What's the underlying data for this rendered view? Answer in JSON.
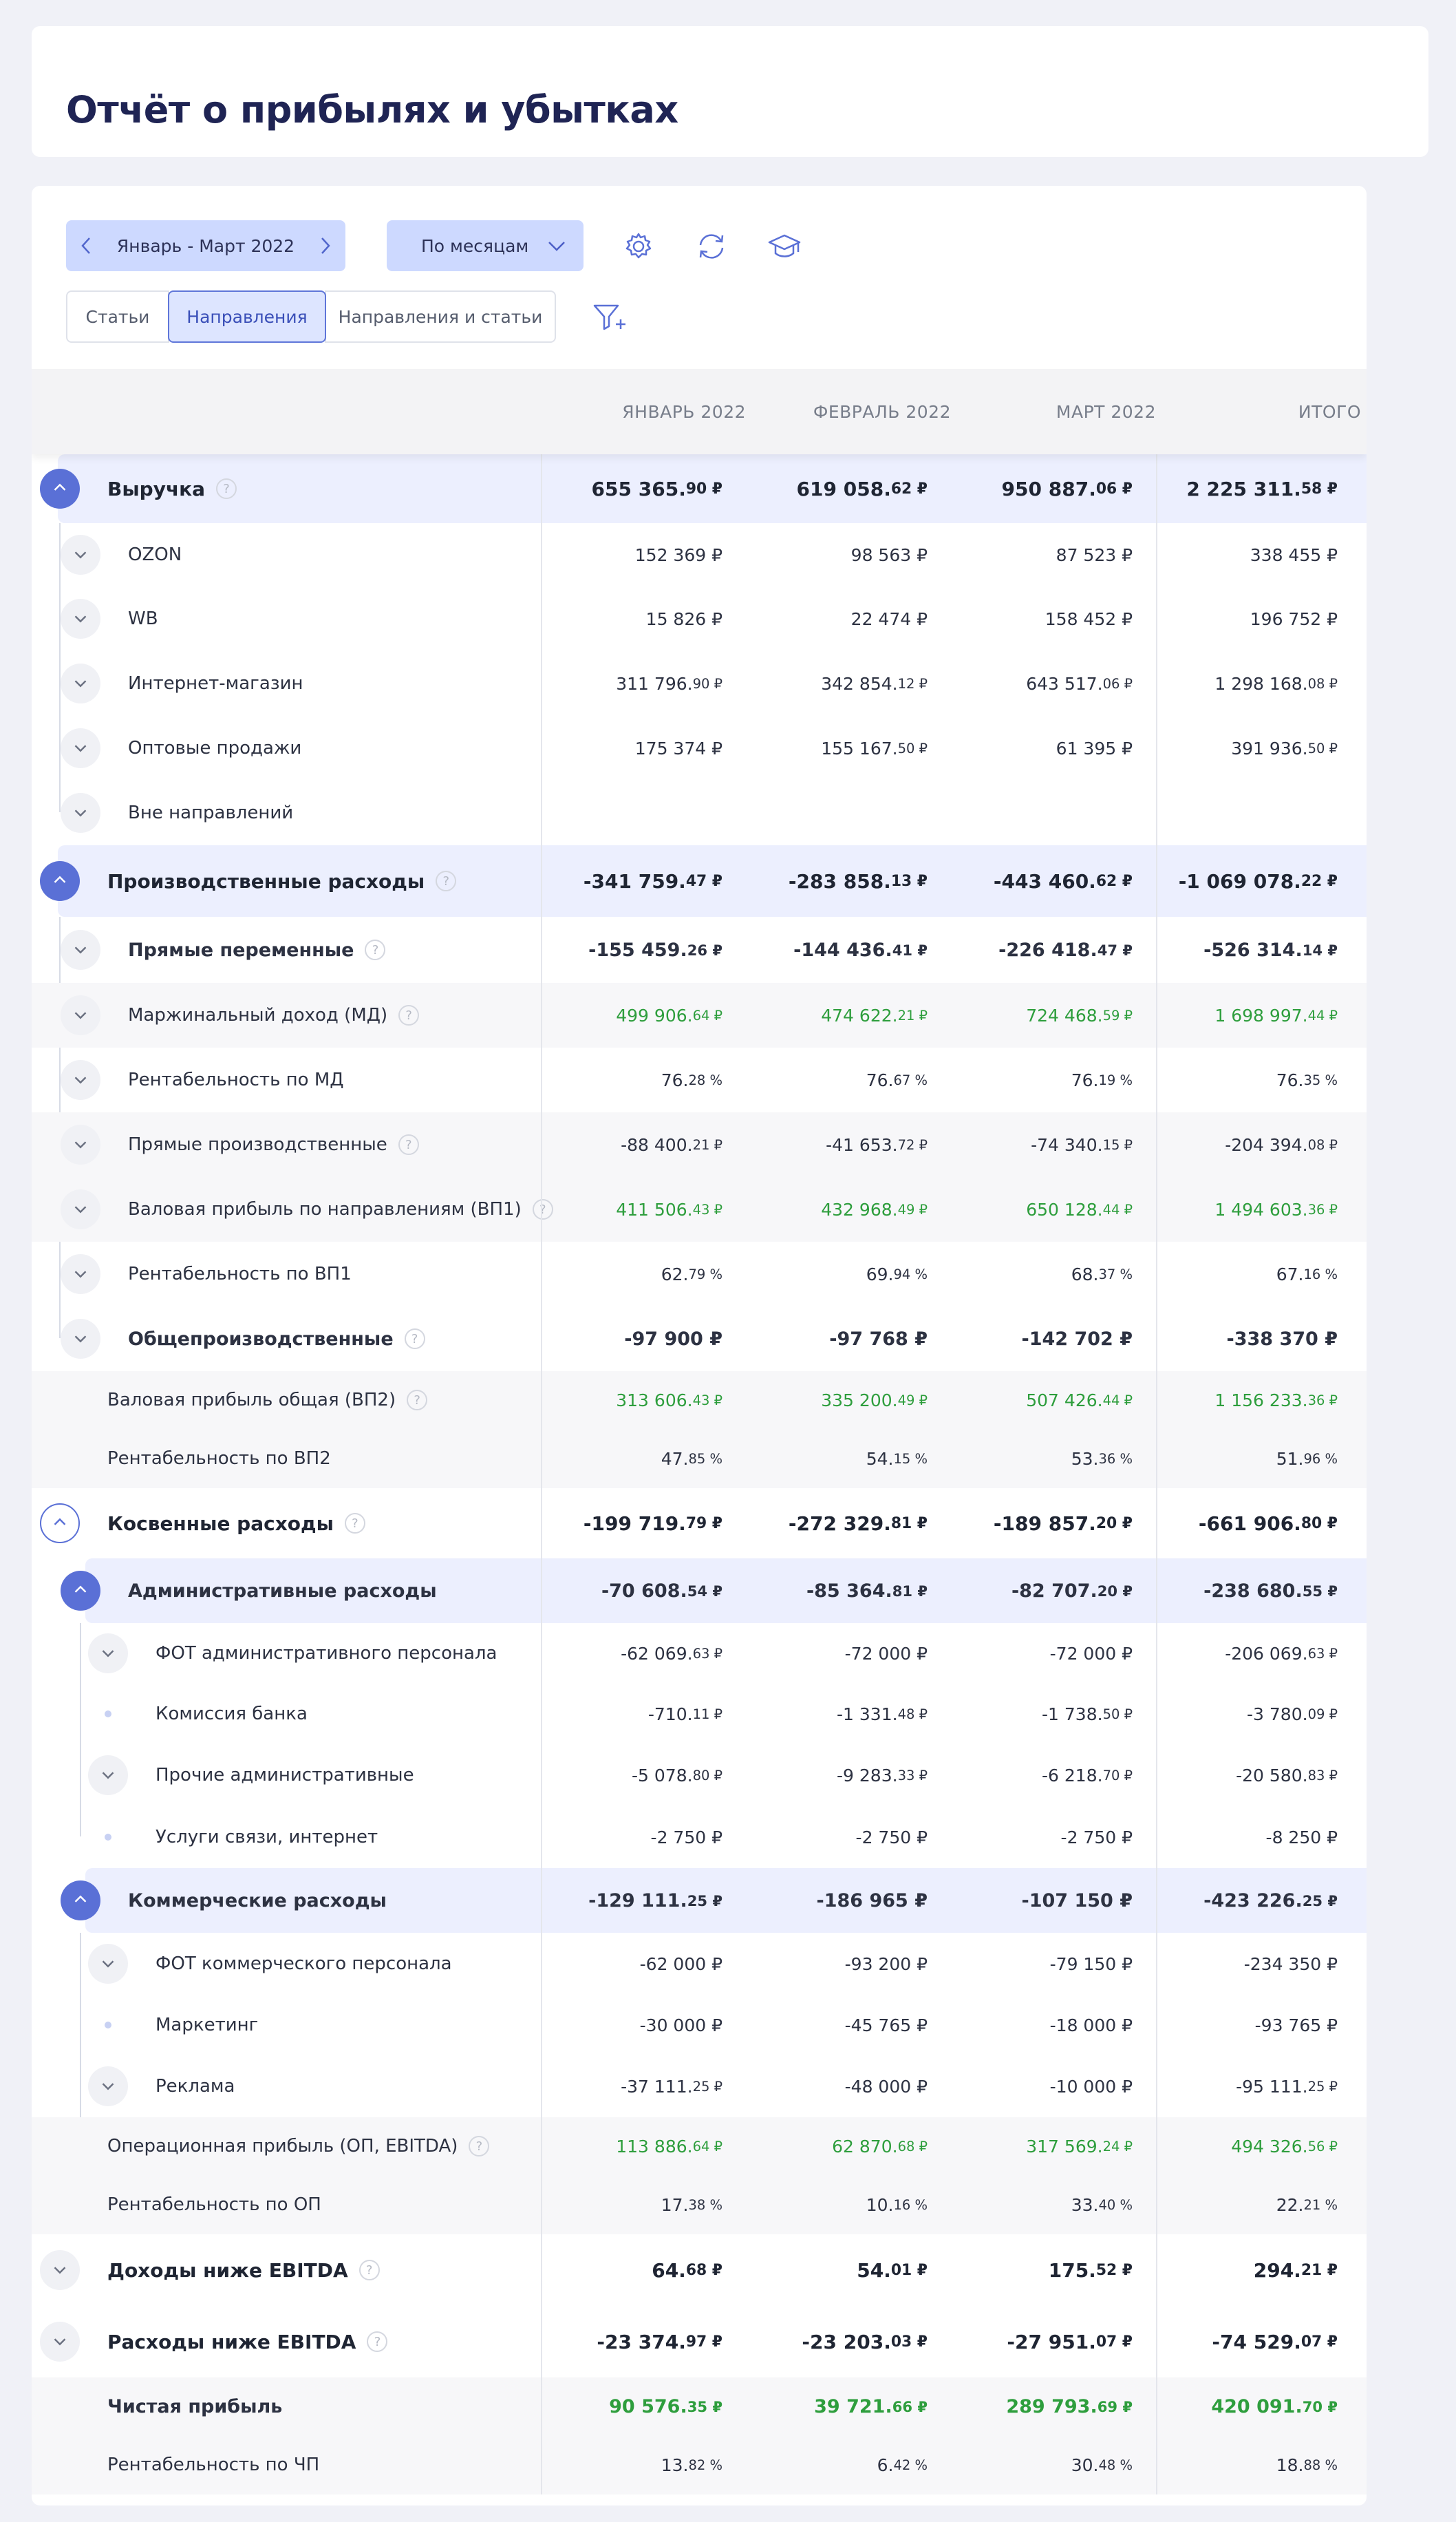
{
  "page": {
    "title": "Отчёт о прибылях и убытках"
  },
  "toolbar": {
    "period_label": "Январь - Март 2022",
    "group_by": "По месяцам",
    "icons": [
      "gear-icon",
      "refresh-icon",
      "graduation-cap-icon",
      "filter-plus-icon"
    ],
    "accent": "#5a70d6"
  },
  "tabs": [
    {
      "label": "Статьи"
    },
    {
      "label": "Направления",
      "active": true
    },
    {
      "label": "Направления и статьи"
    }
  ],
  "columns": [
    "ЯНВАРЬ 2022",
    "ФЕВРАЛЬ 2022",
    "МАРТ 2022",
    "ИТОГО"
  ],
  "rows": [
    {
      "label": "Выручка",
      "vals": [
        [
          "655 365.",
          "90 ₽"
        ],
        [
          "619 058.",
          "62 ₽"
        ],
        [
          "950 887.",
          "06 ₽"
        ],
        [
          "2 225 311.",
          "58 ₽"
        ]
      ]
    },
    {
      "label": "OZON",
      "vals": [
        [
          "152 369 ₽",
          ""
        ],
        [
          "98 563 ₽",
          ""
        ],
        [
          "87 523 ₽",
          ""
        ],
        [
          "338 455 ₽",
          ""
        ]
      ]
    },
    {
      "label": "WB",
      "vals": [
        [
          "15 826 ₽",
          ""
        ],
        [
          "22 474 ₽",
          ""
        ],
        [
          "158 452 ₽",
          ""
        ],
        [
          "196 752 ₽",
          ""
        ]
      ]
    },
    {
      "label": "Интернет-магазин",
      "vals": [
        [
          "311 796.",
          "90 ₽"
        ],
        [
          "342 854.",
          "12 ₽"
        ],
        [
          "643 517.",
          "06 ₽"
        ],
        [
          "1 298 168.",
          "08 ₽"
        ]
      ]
    },
    {
      "label": "Оптовые продажи",
      "vals": [
        [
          "175 374 ₽",
          ""
        ],
        [
          "155 167.",
          "50 ₽"
        ],
        [
          "61 395 ₽",
          ""
        ],
        [
          "391 936.",
          "50 ₽"
        ]
      ]
    },
    {
      "label": "Вне направлений",
      "vals": []
    },
    {
      "label": "Производственные расходы",
      "vals": [
        [
          "-341 759.",
          "47 ₽"
        ],
        [
          "-283 858.",
          "13 ₽"
        ],
        [
          "-443 460.",
          "62 ₽"
        ],
        [
          "-1 069 078.",
          "22 ₽"
        ]
      ]
    },
    {
      "label": "Прямые переменные",
      "vals": [
        [
          "-155 459.",
          "26 ₽"
        ],
        [
          "-144 436.",
          "41 ₽"
        ],
        [
          "-226 418.",
          "47 ₽"
        ],
        [
          "-526 314.",
          "14 ₽"
        ]
      ]
    },
    {
      "label": "Маржинальный доход (МД)",
      "vals": [
        [
          "499 906.",
          "64 ₽"
        ],
        [
          "474 622.",
          "21 ₽"
        ],
        [
          "724 468.",
          "59 ₽"
        ],
        [
          "1 698 997.",
          "44 ₽"
        ]
      ]
    },
    {
      "label": "Рентабельность по МД",
      "vals": [
        [
          "76.",
          "28 %"
        ],
        [
          "76.",
          "67 %"
        ],
        [
          "76.",
          "19 %"
        ],
        [
          "76.",
          "35 %"
        ]
      ]
    },
    {
      "label": "Прямые производственные",
      "vals": [
        [
          "-88 400.",
          "21 ₽"
        ],
        [
          "-41 653.",
          "72 ₽"
        ],
        [
          "-74 340.",
          "15 ₽"
        ],
        [
          "-204 394.",
          "08 ₽"
        ]
      ]
    },
    {
      "label": "Валовая прибыль по направлениям (ВП1)",
      "vals": [
        [
          "411 506.",
          "43 ₽"
        ],
        [
          "432 968.",
          "49 ₽"
        ],
        [
          "650 128.",
          "44 ₽"
        ],
        [
          "1 494 603.",
          "36 ₽"
        ]
      ]
    },
    {
      "label": "Рентабельность по ВП1",
      "vals": [
        [
          "62.",
          "79 %"
        ],
        [
          "69.",
          "94 %"
        ],
        [
          "68.",
          "37 %"
        ],
        [
          "67.",
          "16 %"
        ]
      ]
    },
    {
      "label": "Общепроизводственные",
      "vals": [
        [
          "-97 900 ₽",
          ""
        ],
        [
          "-97 768 ₽",
          ""
        ],
        [
          "-142 702 ₽",
          ""
        ],
        [
          "-338 370 ₽",
          ""
        ]
      ]
    },
    {
      "label": "Валовая прибыль общая (ВП2)",
      "vals": [
        [
          "313 606.",
          "43 ₽"
        ],
        [
          "335 200.",
          "49 ₽"
        ],
        [
          "507 426.",
          "44 ₽"
        ],
        [
          "1 156 233.",
          "36 ₽"
        ]
      ]
    },
    {
      "label": "Рентабельность по ВП2",
      "vals": [
        [
          "47.",
          "85 %"
        ],
        [
          "54.",
          "15 %"
        ],
        [
          "53.",
          "36 %"
        ],
        [
          "51.",
          "96 %"
        ]
      ]
    },
    {
      "label": "Косвенные расходы",
      "vals": [
        [
          "-199 719.",
          "79 ₽"
        ],
        [
          "-272 329.",
          "81 ₽"
        ],
        [
          "-189 857.",
          "20 ₽"
        ],
        [
          "-661 906.",
          "80 ₽"
        ]
      ]
    },
    {
      "label": "Административные расходы",
      "vals": [
        [
          "-70 608.",
          "54 ₽"
        ],
        [
          "-85 364.",
          "81 ₽"
        ],
        [
          "-82 707.",
          "20 ₽"
        ],
        [
          "-238 680.",
          "55 ₽"
        ]
      ]
    },
    {
      "label": "ФОТ административного персонала",
      "vals": [
        [
          "-62 069.",
          "63 ₽"
        ],
        [
          "-72 000 ₽",
          ""
        ],
        [
          "-72 000 ₽",
          ""
        ],
        [
          "-206 069.",
          "63 ₽"
        ]
      ]
    },
    {
      "label": "Комиссия банка",
      "vals": [
        [
          "-710.",
          "11 ₽"
        ],
        [
          "-1 331.",
          "48 ₽"
        ],
        [
          "-1 738.",
          "50 ₽"
        ],
        [
          "-3 780.",
          "09 ₽"
        ]
      ]
    },
    {
      "label": "Прочие административные",
      "vals": [
        [
          "-5 078.",
          "80 ₽"
        ],
        [
          "-9 283.",
          "33 ₽"
        ],
        [
          "-6 218.",
          "70 ₽"
        ],
        [
          "-20 580.",
          "83 ₽"
        ]
      ]
    },
    {
      "label": "Услуги связи, интернет",
      "vals": [
        [
          "-2 750 ₽",
          ""
        ],
        [
          "-2 750 ₽",
          ""
        ],
        [
          "-2 750 ₽",
          ""
        ],
        [
          "-8 250 ₽",
          ""
        ]
      ]
    },
    {
      "label": "Коммерческие расходы",
      "vals": [
        [
          "-129 111.",
          "25 ₽"
        ],
        [
          "-186 965 ₽",
          ""
        ],
        [
          "-107 150 ₽",
          ""
        ],
        [
          "-423 226.",
          "25 ₽"
        ]
      ]
    },
    {
      "label": "ФОТ коммерческого персонала",
      "vals": [
        [
          "-62 000 ₽",
          ""
        ],
        [
          "-93 200 ₽",
          ""
        ],
        [
          "-79 150 ₽",
          ""
        ],
        [
          "-234 350 ₽",
          ""
        ]
      ]
    },
    {
      "label": "Маркетинг",
      "vals": [
        [
          "-30 000 ₽",
          ""
        ],
        [
          "-45 765 ₽",
          ""
        ],
        [
          "-18 000 ₽",
          ""
        ],
        [
          "-93 765 ₽",
          ""
        ]
      ]
    },
    {
      "label": "Реклама",
      "vals": [
        [
          "-37 111.",
          "25 ₽"
        ],
        [
          "-48 000 ₽",
          ""
        ],
        [
          "-10 000 ₽",
          ""
        ],
        [
          "-95 111.",
          "25 ₽"
        ]
      ]
    },
    {
      "label": "Операционная прибыль (ОП, EBITDA)",
      "vals": [
        [
          "113 886.",
          "64 ₽"
        ],
        [
          "62 870.",
          "68 ₽"
        ],
        [
          "317 569.",
          "24 ₽"
        ],
        [
          "494 326.",
          "56 ₽"
        ]
      ]
    },
    {
      "label": "Рентабельность по ОП",
      "vals": [
        [
          "17.",
          "38 %"
        ],
        [
          "10.",
          "16 %"
        ],
        [
          "33.",
          "40 %"
        ],
        [
          "22.",
          "21 %"
        ]
      ]
    },
    {
      "label": "Доходы ниже EBITDA",
      "vals": [
        [
          "64.",
          "68 ₽"
        ],
        [
          "54.",
          "01 ₽"
        ],
        [
          "175.",
          "52 ₽"
        ],
        [
          "294.",
          "21 ₽"
        ]
      ]
    },
    {
      "label": "Расходы ниже EBITDA",
      "vals": [
        [
          "-23 374.",
          "97 ₽"
        ],
        [
          "-23 203.",
          "03 ₽"
        ],
        [
          "-27 951.",
          "07 ₽"
        ],
        [
          "-74 529.",
          "07 ₽"
        ]
      ]
    },
    {
      "label": "Чистая прибыль",
      "vals": [
        [
          "90 576.",
          "35 ₽"
        ],
        [
          "39 721.",
          "66 ₽"
        ],
        [
          "289 793.",
          "69 ₽"
        ],
        [
          "420 091.",
          "70 ₽"
        ]
      ]
    },
    {
      "label": "Рентабельность по ЧП",
      "vals": [
        [
          "13.",
          "82 %"
        ],
        [
          "6.",
          "42 %"
        ],
        [
          "30.",
          "48 %"
        ],
        [
          "18.",
          "88 %"
        ]
      ]
    }
  ],
  "colors": {
    "positive": "#2e9e3d",
    "row_highlight": "#eceffe",
    "row_shaded": "#f7f7f9"
  }
}
